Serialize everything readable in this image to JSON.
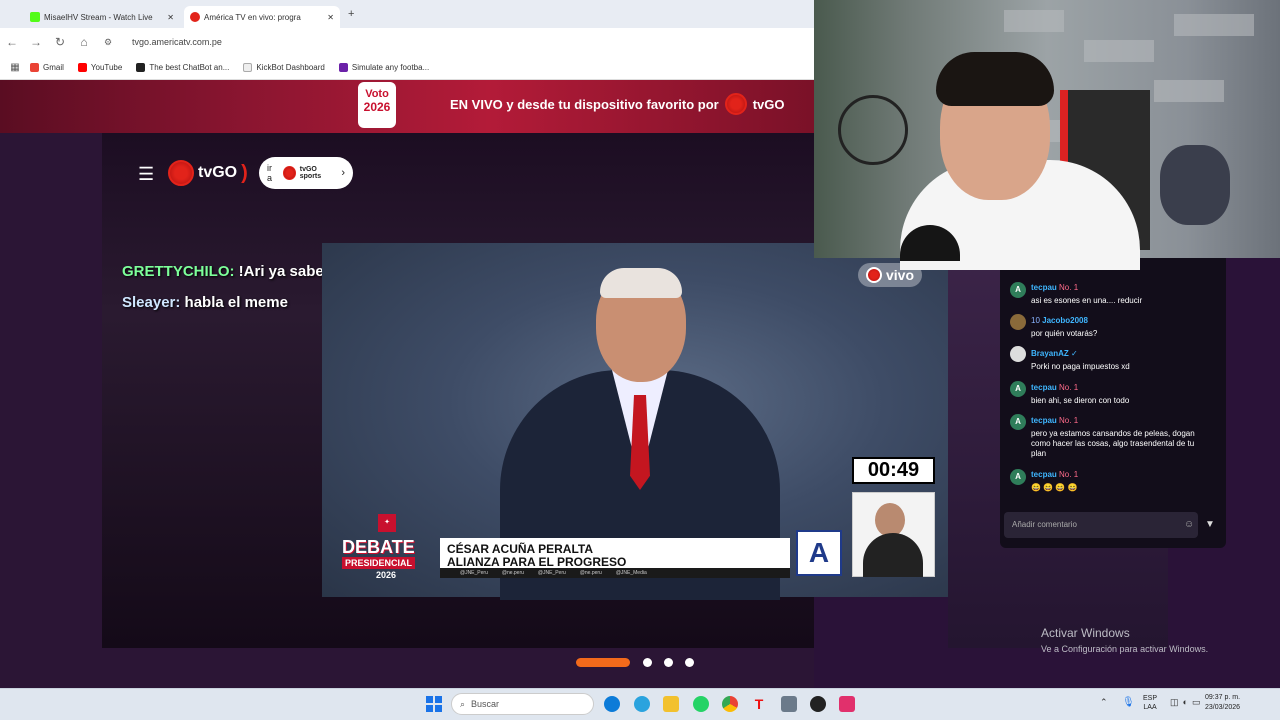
{
  "browser": {
    "tabs": [
      {
        "label": "MisaelHV Stream - Watch Live",
        "active": false
      },
      {
        "label": "América TV en vivo: progra",
        "active": true
      }
    ],
    "new_tab": "+",
    "url": "tvgo.americatv.com.pe",
    "bookmarks": [
      "Gmail",
      "YouTube",
      "The best ChatBot an...",
      "KickBot Dashboard",
      "Simulate any footba..."
    ]
  },
  "site": {
    "banner_badge_top": "Voto",
    "banner_badge_year": "2026",
    "banner_text": "EN VIVO y desde tu dispositivo favorito por",
    "banner_brand": "tvGO",
    "logo": "tvGO",
    "ira_prefix": "ir a",
    "ira_brand": "tvGO sports"
  },
  "overlay_chat": [
    {
      "user": "GRETTYCHILO:",
      "text": "!Ari ya sabes porquien votar?"
    },
    {
      "user": "Sleayer:",
      "text": "habla el meme"
    }
  ],
  "video": {
    "live_badge": "vivo",
    "timer": "00:49",
    "debate_word": "DEBATE",
    "debate_sub": "PRESIDENCIAL",
    "debate_year": "2026",
    "candidate_name": "CÉSAR ACUÑA PERALTA",
    "candidate_party": "ALIANZA PARA EL PROGRESO",
    "party_letter": "A",
    "social_handles": [
      "@JNE_Peru",
      "@ne.peru",
      "@JNE_Peru",
      "@ne.peru",
      "@JNE_Media"
    ]
  },
  "chat": {
    "messages": [
      {
        "avatar": "A",
        "user": "tecpau",
        "badge": "No. 1",
        "text": "asi es esones en una.... reducir",
        "user_color": "#3fb6ff"
      },
      {
        "avatar": "",
        "user": "Jacobo2008",
        "badge": "10",
        "text": "por quién votarás?",
        "user_color": "#3fb6ff"
      },
      {
        "avatar": "",
        "user": "BrayanAZ",
        "badge": "",
        "text": "Porki no paga impuestos xd",
        "user_color": "#3fb6ff"
      },
      {
        "avatar": "A",
        "user": "tecpau",
        "badge": "No. 1",
        "text": "bien ahi, se dieron con todo",
        "user_color": "#3fb6ff"
      },
      {
        "avatar": "A",
        "user": "tecpau",
        "badge": "No. 1",
        "text": "pero ya estamos cansandos de peleas, dogan como hacer las cosas, algo trasendental de tu plan",
        "user_color": "#3fb6ff"
      },
      {
        "avatar": "A",
        "user": "tecpau",
        "badge": "No. 1",
        "text": "😄 😄 😄 😄",
        "user_color": "#3fb6ff"
      }
    ],
    "input_placeholder": "Añadir comentario"
  },
  "windows_activation": {
    "title": "Activar Windows",
    "subtitle": "Ve a Configuración para activar Windows."
  },
  "taskbar": {
    "search_placeholder": "Buscar",
    "lang_top": "ESP",
    "lang_bottom": "LAA",
    "time": "09:37 p. m.",
    "date": "23/03/2026"
  },
  "colors": {
    "brand_red": "#e2231a",
    "carousel_active": "#f26a1b",
    "chat_bg": "#120d1a"
  }
}
